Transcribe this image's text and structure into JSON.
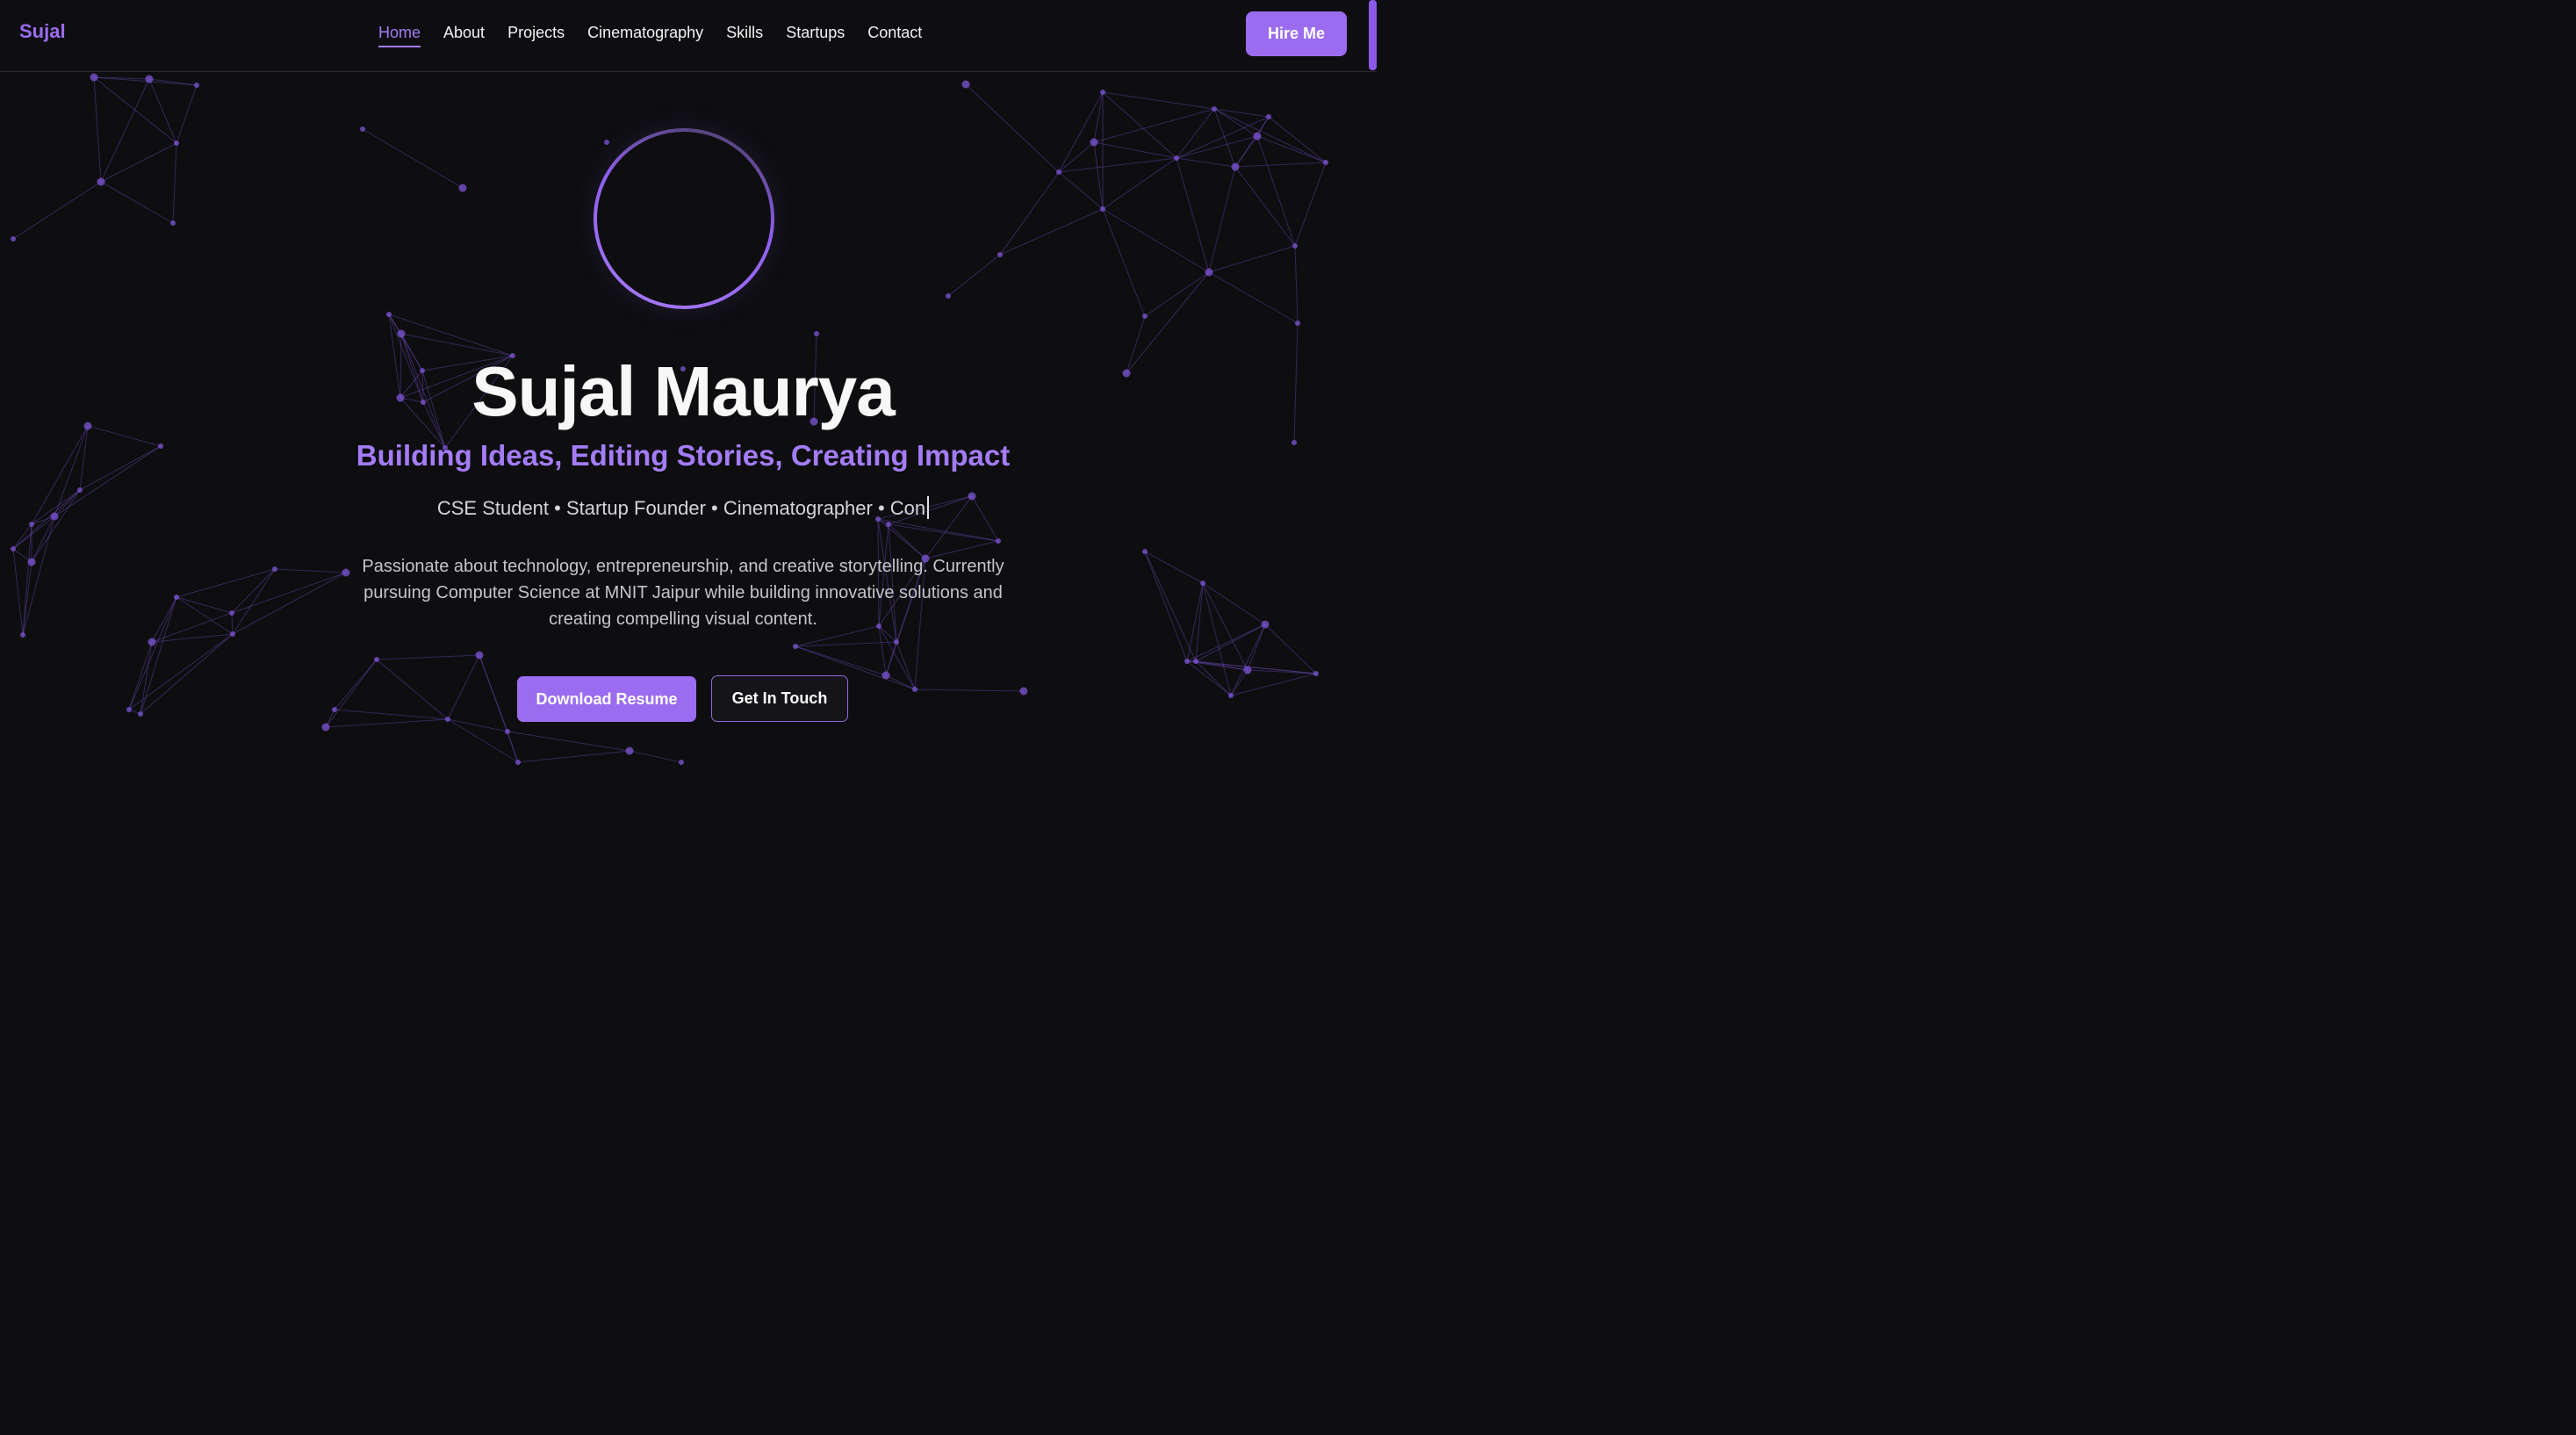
{
  "navbar": {
    "logo": "Sujal",
    "links": [
      "Home",
      "About",
      "Projects",
      "Cinematography",
      "Skills",
      "Startups",
      "Contact"
    ],
    "active": "Home",
    "cta": "Hire Me"
  },
  "hero": {
    "name": "Sujal Maurya",
    "tagline": "Building Ideas, Editing Stories, Creating Impact",
    "roles_typed": "CSE Student • Startup Founder • Cinematographer • Con",
    "description": "Passionate about technology, entrepreneurship, and creative storytelling. Currently pursuing Computer Science at MNIT Jaipur while building innovative solutions and creating compelling visual content.",
    "primary_button": "Download Resume",
    "secondary_button": "Get In Touch"
  },
  "theme": {
    "background": "#0e0e11",
    "accent": "#9b6cf0",
    "accent_light": "#a47cf6",
    "text": "#f7f7f8",
    "network_color": "#7d55d6"
  },
  "icons": {
    "avatar": "avatar-ring",
    "background": "particle-network"
  }
}
